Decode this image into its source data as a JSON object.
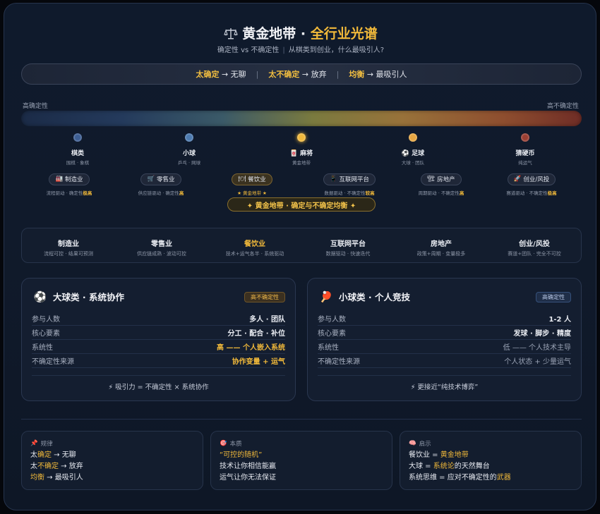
{
  "header": {
    "icon": "balance-scale-icon",
    "title_main": "黄金地带",
    "title_sep": " · ",
    "title_accent": "全行业光谱",
    "subtitle_left": "确定性 vs 不确定性",
    "subtitle_sep": "|",
    "subtitle_right": "从棋类到创业，什么最吸引人?"
  },
  "rule_bar": [
    {
      "key": "太确定",
      "arrow": " → ",
      "val": "无聊"
    },
    {
      "key": "太不确定",
      "arrow": " → ",
      "val": "放弃"
    },
    {
      "key": "均衡",
      "arrow": " → ",
      "val": "最吸引人"
    }
  ],
  "rule_sep": "|",
  "spectrum": {
    "left_label": "高确定性",
    "right_label": "高不确定性",
    "nodes": [
      {
        "icon": "",
        "name": "棋类",
        "desc": "围棋 · 象棋",
        "color": "#3e5f94"
      },
      {
        "icon": "",
        "name": "小球",
        "desc": "乒乓 · 网球",
        "color": "#4d7bb0"
      },
      {
        "icon": "🀄",
        "name": "麻将",
        "desc": "黄金地带",
        "color": "#f0b83c"
      },
      {
        "icon": "⚽",
        "name": "足球",
        "desc": "大球 · 团队",
        "color": "#e7a642"
      },
      {
        "icon": "",
        "name": "猜硬币",
        "desc": "纯运气",
        "color": "#9b3f33"
      }
    ]
  },
  "industries": [
    {
      "icon": "🏭",
      "label": "制造业",
      "note_pre": "流程驱动 · 确定性",
      "note_hl": "极高"
    },
    {
      "icon": "🛒",
      "label": "零售业",
      "note_pre": "供应链驱动 · 确定性",
      "note_hl": "高"
    },
    {
      "icon": "🍽",
      "label": "餐饮业",
      "note_pre": "★ 黄金地带 ★",
      "note_hl": ""
    },
    {
      "icon": "📱",
      "label": "互联网平台",
      "note_pre": "数据驱动 · 不确定性",
      "note_hl": "较高"
    },
    {
      "icon": "🏗",
      "label": "房地产",
      "note_pre": "周期驱动 · 不确定性",
      "note_hl": "高"
    },
    {
      "icon": "🚀",
      "label": "创业/风投",
      "note_pre": "赛道驱动 · 不确定性",
      "note_hl": "极高"
    }
  ],
  "gold_band": "✦ 黄金地带 · 确定与不确定均衡 ✦",
  "industry_panel": [
    {
      "title": "制造业",
      "sub": "流程可控 · 结果可预测"
    },
    {
      "title": "零售业",
      "sub": "供应链成熟 · 波动可控"
    },
    {
      "title": "餐饮业",
      "sub": "技术+运气各半 · 系统驱动"
    },
    {
      "title": "互联网平台",
      "sub": "数据驱动 · 快速迭代"
    },
    {
      "title": "房地产",
      "sub": "政策+周期 · 变量极多"
    },
    {
      "title": "创业/风投",
      "sub": "赛道+团队 · 完全不可控"
    }
  ],
  "card_big": {
    "icon": "soccer-ball-icon",
    "emoji": "⚽",
    "title": "大球类 · 系统协作",
    "badge": "高不确定性",
    "rows": [
      {
        "k": "参与人数",
        "v": "多人 · 团队"
      },
      {
        "k": "核心要素",
        "v": "分工 · 配合 · 补位"
      },
      {
        "k": "系统性",
        "v": "高 —— 个人嵌入系统"
      },
      {
        "k": "不确定性来源",
        "v": "协作变量 + 运气"
      }
    ],
    "foot": "⚡ 吸引力 = 不确定性 × 系统协作"
  },
  "card_small": {
    "icon": "ping-pong-icon",
    "emoji": "🏓",
    "title": "小球类 · 个人竞技",
    "badge": "高确定性",
    "rows": [
      {
        "k": "参与人数",
        "v": "1-2 人"
      },
      {
        "k": "核心要素",
        "v": "发球 · 脚步 · 精度"
      },
      {
        "k": "系统性",
        "v": "低 —— 个人技术主导"
      },
      {
        "k": "不确定性来源",
        "v": "个人状态 + 少量运气"
      }
    ],
    "foot": "⚡ 更接近“纯技术博弈”"
  },
  "notes": [
    {
      "icon": "📌",
      "heading": "规律",
      "lines": [
        [
          "太",
          "确定",
          " → 无聊"
        ],
        [
          "太",
          "不确定",
          " → 放弃"
        ],
        [
          "",
          "均衡",
          " → 最吸引人"
        ]
      ]
    },
    {
      "icon": "🎯",
      "heading": "本质",
      "lines": [
        [
          "",
          "“可控的随机”",
          ""
        ],
        [
          "技术让你相信能赢",
          "",
          ""
        ],
        [
          "运气让你无法保证",
          "",
          ""
        ]
      ]
    },
    {
      "icon": "🧠",
      "heading": "启示",
      "lines": [
        [
          "餐饮业 = ",
          "黄金地带",
          ""
        ],
        [
          "大球 = ",
          "系统论",
          "的天然舞台"
        ],
        [
          "系统思维 = 应对不确定性的",
          "武器",
          ""
        ]
      ]
    }
  ]
}
